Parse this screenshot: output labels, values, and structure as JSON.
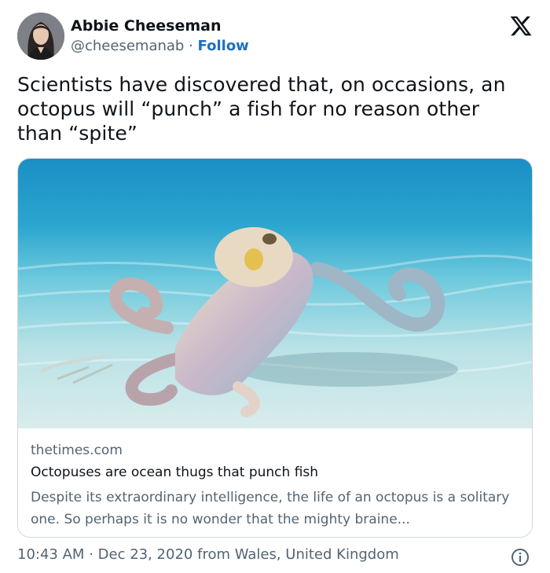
{
  "author": {
    "name": "Abbie Cheeseman",
    "handle": "@cheesemanab",
    "separator": "·",
    "follow_label": "Follow"
  },
  "tweet": {
    "text": "Scientists have discovered that, on occasions, an octopus will “punch” a fish for no reason other than “spite”"
  },
  "link_card": {
    "domain": "thetimes.com",
    "title": "Octopuses are ocean thugs that punch fish",
    "description": "Despite its extraordinary intelligence, the life of an octopus is a solitary one. So perhaps it is no wonder that the mighty braine..."
  },
  "footer": {
    "time": "10:43 AM",
    "separator": "·",
    "date": "Dec 23, 2020",
    "location": "from Wales, United Kingdom"
  },
  "icons": {
    "logo": "x-logo-icon",
    "info": "info-icon"
  },
  "colors": {
    "follow": "#1d6fc2",
    "secondary_text": "#536471",
    "primary_text": "#0f1419",
    "card_border": "#cfd9de"
  }
}
